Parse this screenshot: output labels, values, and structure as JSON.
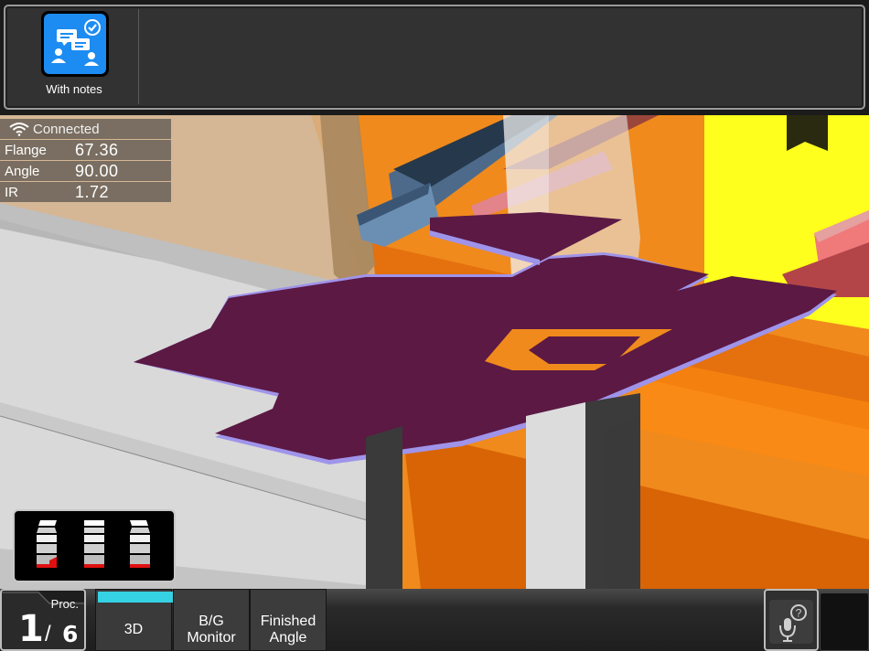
{
  "toolbar": {
    "notes_button": {
      "label": "With notes",
      "icon": "chat-notes-check-icon",
      "color": "#1c8cf2"
    }
  },
  "status": {
    "connection": {
      "label": "Connected",
      "icon": "wifi-icon"
    },
    "rows": [
      {
        "key": "Flange",
        "value": "67.36"
      },
      {
        "key": "Angle",
        "value": "90.00"
      },
      {
        "key": "IR",
        "value": "1.72"
      }
    ]
  },
  "viewport": {
    "description_icons": [
      "tool-selector-icon"
    ],
    "colors": {
      "sheet": "#5b1944",
      "sheet_edge": "#9f94ea",
      "bed": "#f08a1c",
      "highlight": "#ffff1e"
    }
  },
  "bottom": {
    "process": {
      "header": "Proc.",
      "current": "1",
      "separator": "/",
      "total": "6"
    },
    "tabs": [
      {
        "label": "3D",
        "active": true
      },
      {
        "label_line1": "B/G",
        "label_line2": "Monitor"
      },
      {
        "label_line1": "Finished",
        "label_line2": "Angle"
      }
    ],
    "active_color": "#35d2e3",
    "help_icon": "mic-help-icon"
  }
}
